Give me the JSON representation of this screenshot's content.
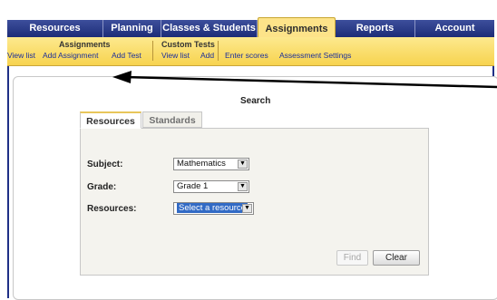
{
  "nav": {
    "tabs": [
      {
        "label": "Resources",
        "active": false
      },
      {
        "label": "Planning",
        "active": false
      },
      {
        "label": "Classes & Students",
        "active": false
      },
      {
        "label": "Assignments",
        "active": true
      },
      {
        "label": "Reports",
        "active": false
      },
      {
        "label": "Account",
        "active": false
      }
    ]
  },
  "submenu": {
    "assignments_title": "Assignments",
    "custom_tests_title": "Custom Tests",
    "links": {
      "view_list": "View list",
      "add_assignment": "Add Assignment",
      "add_test": "Add Test",
      "custom_view_list": "View list",
      "custom_add": "Add",
      "enter_scores": "Enter scores",
      "assessment_settings": "Assessment Settings"
    }
  },
  "search": {
    "title": "Search",
    "tabs": {
      "resources": "Resources",
      "standards": "Standards"
    },
    "fields": {
      "subject_label": "Subject:",
      "subject_value": "Mathematics",
      "grade_label": "Grade:",
      "grade_value": "Grade 1",
      "resources_label": "Resources:",
      "resources_value": "Select a resource"
    },
    "buttons": {
      "find": "Find",
      "clear": "Clear"
    }
  },
  "colors": {
    "nav_bg": "#1d2c77",
    "submenu_bg": "#f7d34f",
    "active_tab": "#fde389",
    "link": "#1c2f9b",
    "selection_highlight": "#316ac5"
  }
}
